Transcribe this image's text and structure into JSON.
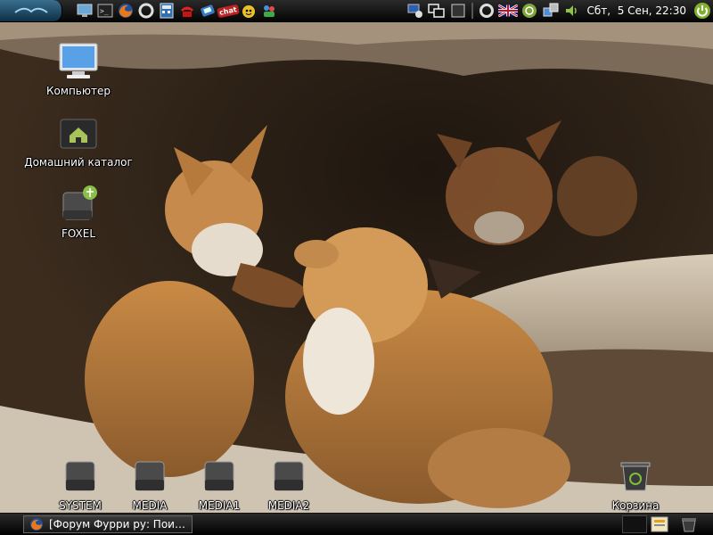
{
  "top_panel": {
    "launchers": [
      {
        "name": "terminal"
      },
      {
        "name": "terminal-console"
      },
      {
        "name": "firefox"
      },
      {
        "name": "opera"
      },
      {
        "name": "calculator"
      },
      {
        "name": "phone"
      },
      {
        "name": "network"
      },
      {
        "name": "chat",
        "text": "chat"
      },
      {
        "name": "pidgin"
      },
      {
        "name": "people"
      }
    ],
    "tray": {
      "keyboard_layout": "en-gb-flag",
      "clock": "Сбт,  5 Сен, 22:30"
    }
  },
  "desktop": {
    "icons": [
      {
        "label": "Компьютер",
        "icon": "computer-icon"
      },
      {
        "label": "Домашний каталог",
        "icon": "home-folder-icon"
      },
      {
        "label": "FOXEL",
        "icon": "usb-drive-icon"
      },
      {
        "label": "SYSTEM",
        "icon": "drive-icon"
      },
      {
        "label": "MEDIA",
        "icon": "drive-icon"
      },
      {
        "label": "MEDIA1",
        "icon": "drive-icon"
      },
      {
        "label": "MEDIA2",
        "icon": "drive-icon"
      },
      {
        "label": "Корзина",
        "icon": "trash-icon"
      }
    ]
  },
  "bottom_panel": {
    "task_title": "[Форум Фурри ру: Пои…"
  },
  "colors": {
    "panel": "#0a0a0a",
    "accent": "#3a6f8f"
  }
}
